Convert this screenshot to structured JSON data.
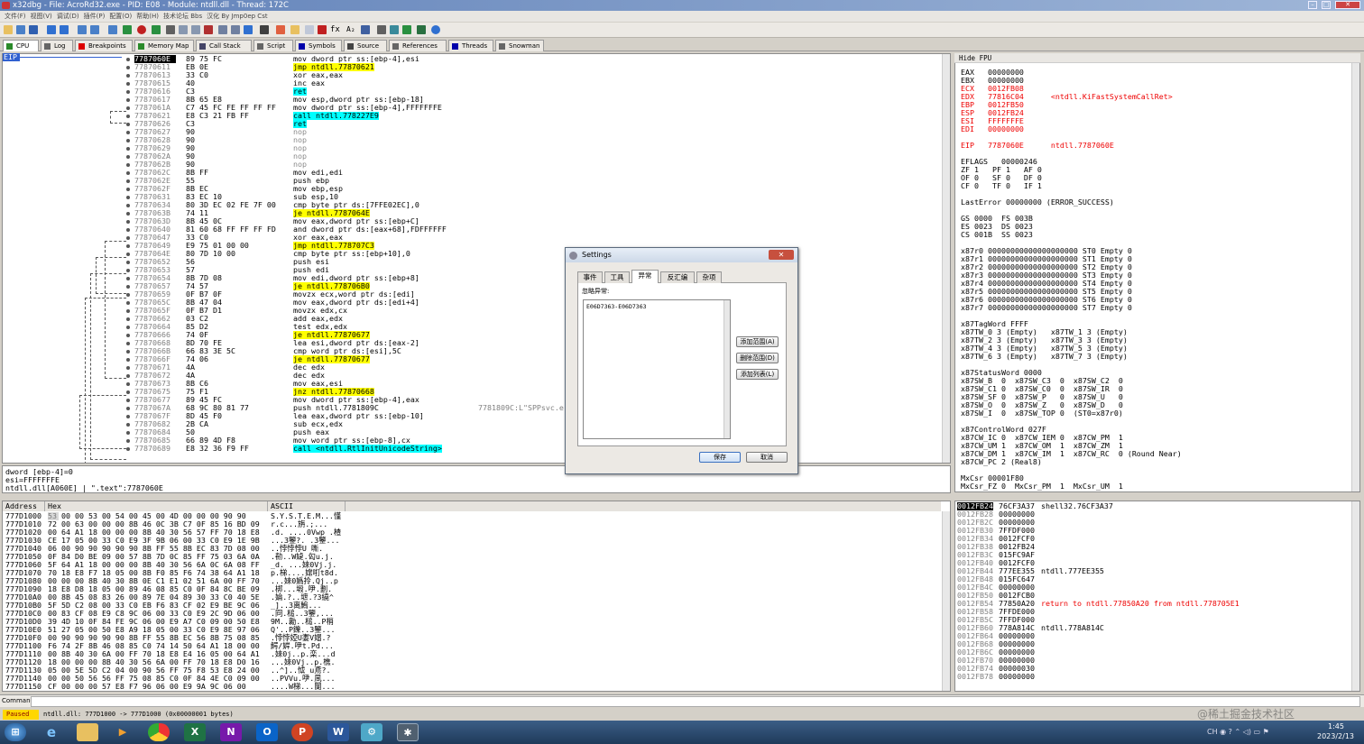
{
  "window": {
    "title": "x32dbg - File: AcroRd32.exe - PID: E08 - Module: ntdll.dll - Thread: 172C"
  },
  "menu": [
    "文件(F)",
    "视图(V)",
    "调试(D)",
    "插件(P)",
    "配置(O)",
    "帮助(H)",
    "技术论坛 Bbs",
    "汉化 By Jmp0ep Cst"
  ],
  "tabs": [
    {
      "label": "CPU",
      "color": "#2a8a2a"
    },
    {
      "label": "Log",
      "color": "#666"
    },
    {
      "label": "Breakpoints",
      "color": "#d00"
    },
    {
      "label": "Memory Map",
      "color": "#2a8a2a"
    },
    {
      "label": "Call Stack",
      "color": "#446"
    },
    {
      "label": "Script",
      "color": "#666"
    },
    {
      "label": "Symbols",
      "color": "#00a"
    },
    {
      "label": "Source",
      "color": "#444"
    },
    {
      "label": "References",
      "color": "#666"
    },
    {
      "label": "Threads",
      "color": "#00a"
    },
    {
      "label": "Snowman",
      "color": "#666"
    }
  ],
  "disasm": {
    "eip_label": "EIP",
    "comment_text": "7781809C:L\"SPPsvc.e",
    "rows": [
      {
        "addr": "7787060E",
        "bytes": "89 75 FC",
        "ins": "mov dword ptr ss:[ebp-4],esi",
        "cur": true
      },
      {
        "addr": "77870611",
        "bytes": "EB 0E",
        "ins": "jmp ntdll.77870621",
        "hl": "y"
      },
      {
        "addr": "77870613",
        "bytes": "33 C0",
        "ins": "xor eax,eax"
      },
      {
        "addr": "77870615",
        "bytes": "40",
        "ins": "inc eax"
      },
      {
        "addr": "77870616",
        "bytes": "C3",
        "ins": "ret",
        "hl": "cy"
      },
      {
        "addr": "77870617",
        "bytes": "8B 65 E8",
        "ins": "mov esp,dword ptr ss:[ebp-18]"
      },
      {
        "addr": "7787061A",
        "bytes": "C7 45 FC FE FF FF FF",
        "ins": "mov dword ptr ss:[ebp-4],FFFFFFFE"
      },
      {
        "addr": "77870621",
        "bytes": "E8 C3 21 FB FF",
        "ins": "call ntdll.778227E9",
        "hl": "cy"
      },
      {
        "addr": "77870626",
        "bytes": "C3",
        "ins": "ret",
        "hl": "cy"
      },
      {
        "addr": "77870627",
        "bytes": "90",
        "ins": "nop",
        "gry": true
      },
      {
        "addr": "77870628",
        "bytes": "90",
        "ins": "nop",
        "gry": true
      },
      {
        "addr": "77870629",
        "bytes": "90",
        "ins": "nop",
        "gry": true
      },
      {
        "addr": "7787062A",
        "bytes": "90",
        "ins": "nop",
        "gry": true
      },
      {
        "addr": "7787062B",
        "bytes": "90",
        "ins": "nop",
        "gry": true
      },
      {
        "addr": "7787062C",
        "bytes": "8B FF",
        "ins": "mov edi,edi"
      },
      {
        "addr": "7787062E",
        "bytes": "55",
        "ins": "push ebp"
      },
      {
        "addr": "7787062F",
        "bytes": "8B EC",
        "ins": "mov ebp,esp"
      },
      {
        "addr": "77870631",
        "bytes": "83 EC 10",
        "ins": "sub esp,10"
      },
      {
        "addr": "77870634",
        "bytes": "80 3D EC 02 FE 7F 00",
        "ins": "cmp byte ptr ds:[7FFE02EC],0"
      },
      {
        "addr": "7787063B",
        "bytes": "74 11",
        "ins": "je ntdll.7787064E",
        "hl": "y"
      },
      {
        "addr": "7787063D",
        "bytes": "8B 45 0C",
        "ins": "mov eax,dword ptr ss:[ebp+C]"
      },
      {
        "addr": "77870640",
        "bytes": "81 60 68 FF FF FF FD",
        "ins": "and dword ptr ds:[eax+68],FDFFFFFF"
      },
      {
        "addr": "77870647",
        "bytes": "33 C0",
        "ins": "xor eax,eax"
      },
      {
        "addr": "77870649",
        "bytes": "E9 75 01 00 00",
        "ins": "jmp ntdll.778707C3",
        "hl": "y"
      },
      {
        "addr": "7787064E",
        "bytes": "80 7D 10 00",
        "ins": "cmp byte ptr ss:[ebp+10],0"
      },
      {
        "addr": "77870652",
        "bytes": "56",
        "ins": "push esi"
      },
      {
        "addr": "77870653",
        "bytes": "57",
        "ins": "push edi"
      },
      {
        "addr": "77870654",
        "bytes": "8B 7D 08",
        "ins": "mov edi,dword ptr ss:[ebp+8]"
      },
      {
        "addr": "77870657",
        "bytes": "74 57",
        "ins": "je ntdll.778706B0",
        "hl": "y"
      },
      {
        "addr": "77870659",
        "bytes": "0F B7 0F",
        "ins": "movzx ecx,word ptr ds:[edi]"
      },
      {
        "addr": "7787065C",
        "bytes": "8B 47 04",
        "ins": "mov eax,dword ptr ds:[edi+4]"
      },
      {
        "addr": "7787065F",
        "bytes": "0F B7 D1",
        "ins": "movzx edx,cx"
      },
      {
        "addr": "77870662",
        "bytes": "03 C2",
        "ins": "add eax,edx"
      },
      {
        "addr": "77870664",
        "bytes": "85 D2",
        "ins": "test edx,edx"
      },
      {
        "addr": "77870666",
        "bytes": "74 0F",
        "ins": "je ntdll.77870677",
        "hl": "y"
      },
      {
        "addr": "77870668",
        "bytes": "8D 70 FE",
        "ins": "lea esi,dword ptr ds:[eax-2]"
      },
      {
        "addr": "7787066B",
        "bytes": "66 83 3E 5C",
        "ins": "cmp word ptr ds:[esi],5C"
      },
      {
        "addr": "7787066F",
        "bytes": "74 06",
        "ins": "je ntdll.77870677",
        "hl": "y"
      },
      {
        "addr": "77870671",
        "bytes": "4A",
        "ins": "dec edx"
      },
      {
        "addr": "77870672",
        "bytes": "4A",
        "ins": "dec edx"
      },
      {
        "addr": "77870673",
        "bytes": "8B C6",
        "ins": "mov eax,esi"
      },
      {
        "addr": "77870675",
        "bytes": "75 F1",
        "ins": "jnz ntdll.77870668",
        "hl": "y"
      },
      {
        "addr": "77870677",
        "bytes": "89 45 FC",
        "ins": "mov dword ptr ss:[ebp-4],eax"
      },
      {
        "addr": "7787067A",
        "bytes": "68 9C 80 81 77",
        "ins": "push ntdll.7781809C",
        "comment": true
      },
      {
        "addr": "7787067F",
        "bytes": "8D 45 F0",
        "ins": "lea eax,dword ptr ss:[ebp-10]"
      },
      {
        "addr": "77870682",
        "bytes": "2B CA",
        "ins": "sub ecx,edx"
      },
      {
        "addr": "77870684",
        "bytes": "50",
        "ins": "push eax"
      },
      {
        "addr": "77870685",
        "bytes": "66 89 4D F8",
        "ins": "mov word ptr ss:[ebp-8],cx"
      },
      {
        "addr": "77870689",
        "bytes": "E8 32 36 F9 FF",
        "ins": "call <ntdll.RtlInitUnicodeString>",
        "hl": "cy"
      }
    ]
  },
  "info": [
    "dword [ebp-4]=0",
    "esi=FFFFFFFE",
    "ntdll.dll[A060E] | \".text\":7787060E"
  ],
  "registers": {
    "header": "Hide FPU",
    "lines": [
      {
        "t": "EAX   00000000"
      },
      {
        "t": "EBX   00000000"
      },
      {
        "t": "ECX   0012FB08"
      },
      {
        "t": "EDX   77816C04      <ntdll.KiFastSystemCallRet>"
      },
      {
        "t": "EBP   0012FB50"
      },
      {
        "t": "ESP   0012FB24"
      },
      {
        "t": "ESI   FFFFFFFE"
      },
      {
        "t": "EDI   00000000"
      },
      {
        "t": ""
      },
      {
        "t": "EIP   7787060E      ntdll.7787060E"
      },
      {
        "t": ""
      },
      {
        "t": "EFLAGS   00000246"
      },
      {
        "t": "ZF 1   PF 1   AF 0"
      },
      {
        "t": "OF 0   SF 0   DF 0"
      },
      {
        "t": "CF 0   TF 0   IF 1"
      },
      {
        "t": ""
      },
      {
        "t": "LastError 00000000 (ERROR_SUCCESS)"
      },
      {
        "t": ""
      },
      {
        "t": "GS 0000  FS 003B"
      },
      {
        "t": "ES 0023  DS 0023"
      },
      {
        "t": "CS 001B  SS 0023"
      },
      {
        "t": ""
      },
      {
        "t": "x87r0 00000000000000000000 ST0 Empty 0"
      },
      {
        "t": "x87r1 00000000000000000000 ST1 Empty 0"
      },
      {
        "t": "x87r2 00000000000000000000 ST2 Empty 0"
      },
      {
        "t": "x87r3 00000000000000000000 ST3 Empty 0"
      },
      {
        "t": "x87r4 00000000000000000000 ST4 Empty 0"
      },
      {
        "t": "x87r5 00000000000000000000 ST5 Empty 0"
      },
      {
        "t": "x87r6 00000000000000000000 ST6 Empty 0"
      },
      {
        "t": "x87r7 00000000000000000000 ST7 Empty 0"
      },
      {
        "t": ""
      },
      {
        "t": "x87TagWord FFFF"
      },
      {
        "t": "x87TW_0 3 (Empty)   x87TW_1 3 (Empty)"
      },
      {
        "t": "x87TW_2 3 (Empty)   x87TW_3 3 (Empty)"
      },
      {
        "t": "x87TW_4 3 (Empty)   x87TW_5 3 (Empty)"
      },
      {
        "t": "x87TW_6 3 (Empty)   x87TW_7 3 (Empty)"
      },
      {
        "t": ""
      },
      {
        "t": "x87StatusWord 0000"
      },
      {
        "t": "x87SW_B  0  x87SW_C3  0  x87SW_C2  0"
      },
      {
        "t": "x87SW_C1 0  x87SW_C0  0  x87SW_IR  0"
      },
      {
        "t": "x87SW_SF 0  x87SW_P   0  x87SW_U   0"
      },
      {
        "t": "x87SW_O  0  x87SW_Z   0  x87SW_D   0"
      },
      {
        "t": "x87SW_I  0  x87SW_TOP 0  (ST0=x87r0)"
      },
      {
        "t": ""
      },
      {
        "t": "x87ControlWord 027F"
      },
      {
        "t": "x87CW_IC 0  x87CW_IEM 0  x87CW_PM  1"
      },
      {
        "t": "x87CW_UM 1  x87CW_OM  1  x87CW_ZM  1"
      },
      {
        "t": "x87CW_DM 1  x87CW_IM  1  x87CW_RC  0 (Round Near)"
      },
      {
        "t": "x87CW_PC 2 (Real8)"
      },
      {
        "t": ""
      },
      {
        "t": "MxCsr 00001F80"
      },
      {
        "t": "MxCsr_FZ 0  MxCsr_PM  1  MxCsr_UM  1"
      }
    ]
  },
  "dump": {
    "headers": [
      "Address",
      "Hex",
      "ASCII"
    ],
    "rows": [
      [
        "777D1000",
        "53 00 00 53 00 54 00 45 00 4D 00 00 00 90 90",
        "S.Y.S.T.E.M...慬"
      ],
      [
        "777D1010",
        "72 00 63 00 00 00 8B 46 0C 3B C7 0F 85 16 BD 09",
        "r.c...旃.;..."
      ],
      [
        "777D1020",
        "00 64 A1 18 00 00 00 8B 40 30 56 57 FF 70 18 E8",
        ".d. ....0Vwp .楂"
      ],
      [
        "777D1030",
        "CE 17 05 00 33 C0 E9 3F 9B 06 00 33 C0 E9 1E 9B",
        "...3鑒?. .3鑒..."
      ],
      [
        "777D1040",
        "06 00 90 90 90 90 90 8B FF 55 8B EC 83 7D 08 00",
        "..悖悖悖U 嘶."
      ],
      [
        "777D1050",
        "0F 84 D0 BE 09 00 57 8B 7D 0C 85 FF 75 03 6A 0A",
        ".勌..W媫.匃u.j."
      ],
      [
        "777D1060",
        "5F 64 A1 18 00 00 00 8B 40 30 56 6A 0C 6A 08 FF",
        "_d. ...婡0Vj.j."
      ],
      [
        "777D1070",
        "70 18 E8 F7 18 05 00 8B F0 85 F6 74 38 64 A1 18",
        "p.梯....嫦咑t8d."
      ],
      [
        "777D1080",
        "00 00 00 8B 40 30 8B 0E C1 E1 02 51 6A 00 FF 70",
        "...婡0嬀拎.Qj..p"
      ],
      [
        "777D1090",
        "18 E8 D8 18 05 00 89 46 08 85 C0 0F 84 8C BE 09",
        ".梆...塅.吚.劃."
      ],
      [
        "777D10A0",
        "00 8B 45 08 83 26 00 89 7E 04 89 30 33 C0 40 5E",
        ".婨.?..墌.?3繞^"
      ],
      [
        "777D10B0",
        "5F 5D C2 08 00 33 C0 EB F6 83 CF 02 E9 BE 9C 06",
        "_]..3离鰞..."
      ],
      [
        "777D10C0",
        "00 83 CF 08 E9 C8 9C 06 00 33 C0 E9 2C 9D 06 00",
        ".冏.槌..3鑒,..."
      ],
      [
        "777D10D0",
        "39 4D 10 0F 84 FE 9C 06 00 E9 A7 C0 09 00 50 E8",
        "9M..勷..槌..P梢"
      ],
      [
        "777D10E0",
        "51 27 05 00 50 E8 A9 18 05 00 33 C0 E9 8E 97 06",
        "Q'..P鑠..3鑒..."
      ],
      [
        "777D10F0",
        "00 90 90 90 90 90 8B FF 55 8B EC 56 8B 75 08 85",
        ".悖悖婭U嬱V媢.?"
      ],
      [
        "777D1100",
        "F6 74 2F 8B 46 08 85 C0 74 14 50 64 A1 18 00 00",
        "鰐/婩.吚t.Pd..."
      ],
      [
        "777D1110",
        "00 8B 40 30 6A 00 FF 70 18 E8 E4 16 05 00 64 A1",
        ".婡0j..p.栾...d"
      ],
      [
        "777D1120",
        "18 00 00 00 8B 40 30 56 6A 00 FF 70 18 E8 D0 16",
        "...婡0Vj..p.樵."
      ],
      [
        "777D1130",
        "05 00 5E 5D C2 04 00 90 56 FF 75 F8 53 E8 24 00",
        "..^]..怴 u鳶?."
      ],
      [
        "777D1140",
        "00 00 50 56 56 FF 75 08 85 C0 0F 84 4E C0 09 00",
        "..PVVu.吚.凬..."
      ],
      [
        "777D1150",
        "CF 00 00 00 57 E8 F7 96 06 00 E9 9A 9C 06 00",
        "....W梯...闅..."
      ]
    ]
  },
  "stack": {
    "rows": [
      {
        "a": "0012FB24",
        "v": "76CF3A37",
        "c": "shell32.76CF3A37",
        "sel": true
      },
      {
        "a": "0012FB28",
        "v": "00000000",
        "c": ""
      },
      {
        "a": "0012FB2C",
        "v": "00000000",
        "c": ""
      },
      {
        "a": "0012FB30",
        "v": "7FFDF000",
        "c": ""
      },
      {
        "a": "0012FB34",
        "v": "0012FCF0",
        "c": ""
      },
      {
        "a": "0012FB38",
        "v": "0012FB24",
        "c": ""
      },
      {
        "a": "0012FB3C",
        "v": "015FC9AF",
        "c": ""
      },
      {
        "a": "0012FB40",
        "v": "0012FCF0",
        "c": ""
      },
      {
        "a": "0012FB44",
        "v": "777EE355",
        "c": "ntdll.777EE355"
      },
      {
        "a": "0012FB48",
        "v": "015FC647",
        "c": ""
      },
      {
        "a": "0012FB4C",
        "v": "00000000",
        "c": ""
      },
      {
        "a": "0012FB50",
        "v": "0012FCB0",
        "c": ""
      },
      {
        "a": "0012FB54",
        "v": "77850A20",
        "c": "return to ntdll.77850A20 from ntdll.778705E1",
        "red": true
      },
      {
        "a": "0012FB58",
        "v": "7FFDE000",
        "c": ""
      },
      {
        "a": "0012FB5C",
        "v": "7FFDF000",
        "c": ""
      },
      {
        "a": "0012FB60",
        "v": "778A814C",
        "c": "ntdll.778A814C"
      },
      {
        "a": "0012FB64",
        "v": "00000000",
        "c": ""
      },
      {
        "a": "0012FB68",
        "v": "00000000",
        "c": ""
      },
      {
        "a": "0012FB6C",
        "v": "00000000",
        "c": ""
      },
      {
        "a": "0012FB70",
        "v": "00000000",
        "c": ""
      },
      {
        "a": "0012FB74",
        "v": "00000030",
        "c": ""
      },
      {
        "a": "0012FB78",
        "v": "00000000",
        "c": ""
      }
    ]
  },
  "command": {
    "label": "Command:"
  },
  "status": {
    "state": "Paused",
    "text": "ntdll.dll: 777D1000 -> 777D1000 (0x00000001 bytes)"
  },
  "settings_dialog": {
    "title": "Settings",
    "close": "✕",
    "tabs": [
      "事件",
      "工具",
      "异常",
      "反汇编",
      "杂项"
    ],
    "active_tab": 2,
    "group_label": "忽略异常:",
    "list_items": [
      "E06D7363-E06D7363"
    ],
    "buttons": {
      "add_range": "添加范围(A)",
      "delete_range": "删除范围(D)",
      "add_last": "添加列表(L)",
      "save": "保存",
      "cancel": "取消"
    }
  },
  "taskbar": {
    "time": "1:45",
    "date": "2023/2/13",
    "watermark": "@稀土掘金技术社区"
  }
}
